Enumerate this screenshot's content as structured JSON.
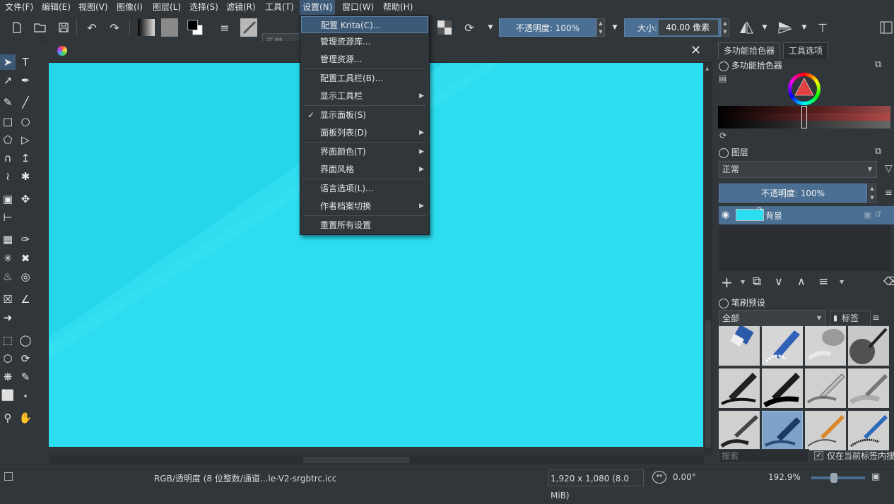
{
  "menubar": [
    "文件(F)",
    "编辑(E)",
    "视图(V)",
    "图像(I)",
    "图层(L)",
    "选择(S)",
    "滤镜(R)",
    "工具(T)",
    "设置(N)",
    "窗口(W)",
    "帮助(H)"
  ],
  "toolbar": {
    "blend_mode": "正常",
    "opacity_label": "不透明度:  100%",
    "size_prefix": "大小:",
    "size_value": "40.00 像素"
  },
  "settings_menu": {
    "items": [
      {
        "label": "配置 Krita(C)...",
        "highlighted": true
      },
      {
        "label": "管理资源库..."
      },
      {
        "label": "管理资源..."
      },
      {
        "label": "配置工具栏(B)..."
      },
      {
        "label": "显示工具栏",
        "submenu": true
      },
      {
        "label": "显示面板(S)",
        "checked": true
      },
      {
        "label": "面板列表(D)",
        "submenu": true
      },
      {
        "label": "界面颜色(T)",
        "submenu": true
      },
      {
        "label": "界面风格",
        "submenu": true
      },
      {
        "label": "语言选项(L)..."
      },
      {
        "label": "作者档案切换",
        "submenu": true
      },
      {
        "label": "重置所有设置"
      }
    ]
  },
  "right_panel": {
    "tabs": [
      "多功能拾色器",
      "工具选项"
    ],
    "color_selector_title": "多功能拾色器",
    "layers_title": "图层",
    "layers_blend": "正常",
    "layers_opacity": "不透明度:  100%",
    "layer_name": "背景",
    "brush_presets_title": "笔刷预设",
    "brush_filter": "全部",
    "tag_label": "标签",
    "search_placeholder": "搜索",
    "search_in_tag": "仅在当前标签内搜索"
  },
  "status_bar": {
    "color_profile": "RGB/透明度 (8 位整数/通道...le-V2-srgbtrc.icc",
    "dimensions": "1,920 x 1,080 (8.0 MiB)",
    "rotation": "0.00°",
    "zoom": "192.9%"
  },
  "colors": {
    "canvas": "#2cdcf0",
    "ui_bg": "#31363b",
    "highlight": "#3c5a78",
    "accent_blue": "#4a6f93"
  }
}
